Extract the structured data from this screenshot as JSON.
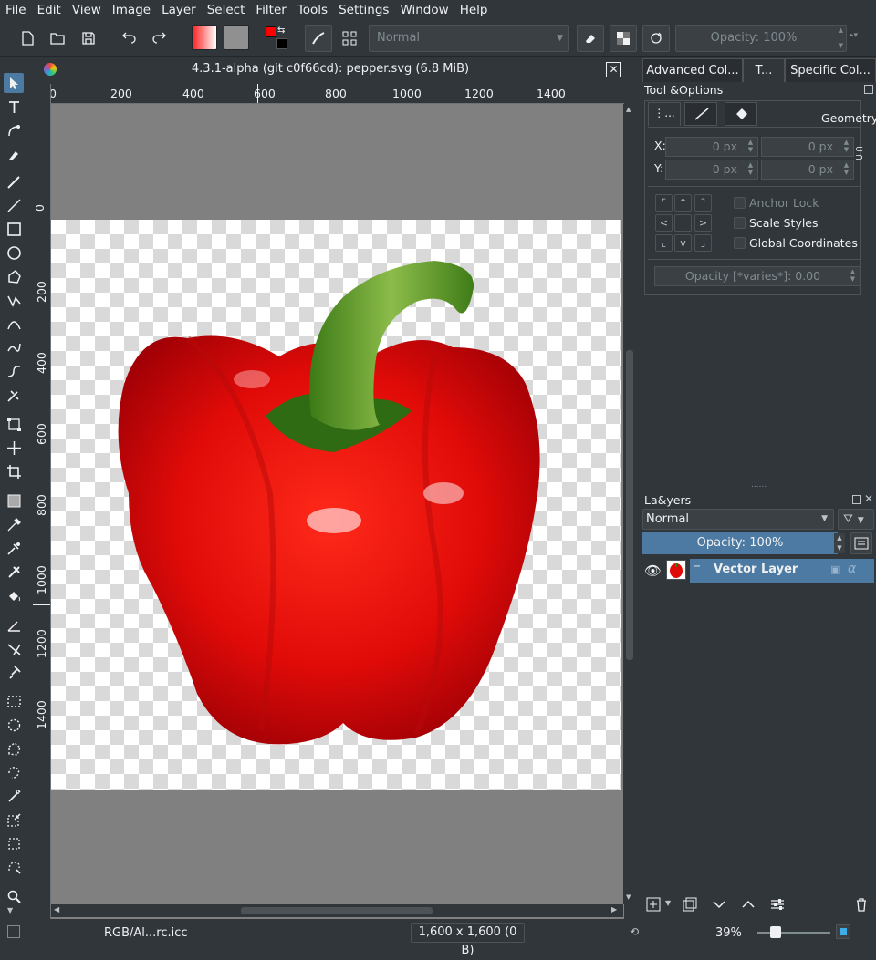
{
  "menubar": {
    "items": [
      "File",
      "Edit",
      "View",
      "Image",
      "Layer",
      "Select",
      "Filter",
      "Tools",
      "Settings",
      "Window",
      "Help"
    ]
  },
  "toolbar": {
    "blend_mode": "Normal",
    "opacity": "Opacity: 100%"
  },
  "document": {
    "title": "4.3.1-alpha (git c0f66cd): pepper.svg (6.8 MiB)"
  },
  "rulers": {
    "horizontal_labels": [
      "0",
      "200",
      "400",
      "600",
      "800",
      "1000",
      "1200",
      "1400"
    ],
    "vertical_labels": [
      "0",
      "200",
      "400",
      "600",
      "800",
      "1000",
      "1200",
      "1400"
    ]
  },
  "docker_tabs": [
    "Advanced Col...",
    "T...",
    "Specific Col..."
  ],
  "tool_options": {
    "title": "Tool &Options",
    "section": "Geometry",
    "x_label": "X:",
    "y_label": "Y:",
    "x_value": "0 px",
    "x2_value": "0 px",
    "y_value": "0 px",
    "y2_value": "0 px",
    "anchor_lock": "Anchor Lock",
    "scale_styles": "Scale Styles",
    "global_coordinates": "Global Coordinates",
    "opacity": "Opacity [*varies*]: 0.00"
  },
  "layers": {
    "title": "La&yers",
    "blend_mode": "Normal",
    "opacity": "Opacity:  100%",
    "items": [
      {
        "name": "Vector Layer"
      }
    ]
  },
  "statusbar": {
    "color_profile": "RGB/Al...rc.icc",
    "image_size": "1,600 x 1,600 (0 B)",
    "zoom": "39%"
  },
  "colors": {
    "background": "#31363b",
    "accent": "#3daee9",
    "layer_selected": "#4d7aa3",
    "canvas_gray": "#808080"
  }
}
